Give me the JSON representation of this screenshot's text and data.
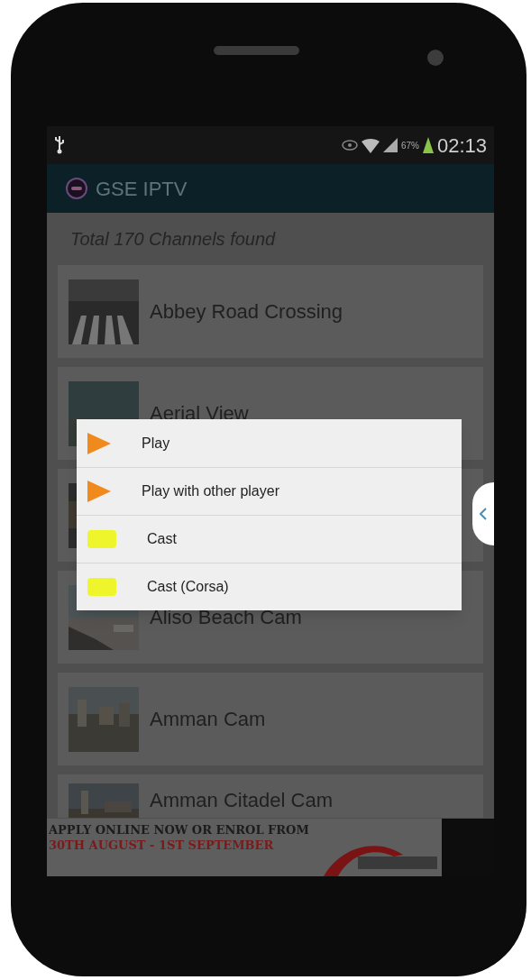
{
  "status_bar": {
    "battery": "67%",
    "time": "02:13"
  },
  "app_bar": {
    "title": "GSE IPTV"
  },
  "summary": "Total 170 Channels found",
  "channels": [
    {
      "name": "Abbey Road Crossing",
      "kind": "picture"
    },
    {
      "name": "Aerial View",
      "kind": "picture"
    },
    {
      "kind": "picture"
    },
    {
      "name": "Aliso Beach Cam",
      "kind": "picture"
    },
    {
      "name": "Amman Cam",
      "kind": "picture"
    },
    {
      "name": "Amman Citadel Cam",
      "kind": "picture"
    }
  ],
  "context_menu": [
    {
      "label": "Play",
      "kind": "play"
    },
    {
      "label": "Play with other player",
      "kind": "play"
    },
    {
      "label": "Cast",
      "kind": "cast"
    },
    {
      "label": "Cast (Corsa)",
      "kind": "cast"
    }
  ],
  "ad_banner": {
    "headline": "APPLY ONLINE NOW OR ENROL FROM",
    "dates": "30TH AUGUST - 1ST SEPTEMBER"
  }
}
